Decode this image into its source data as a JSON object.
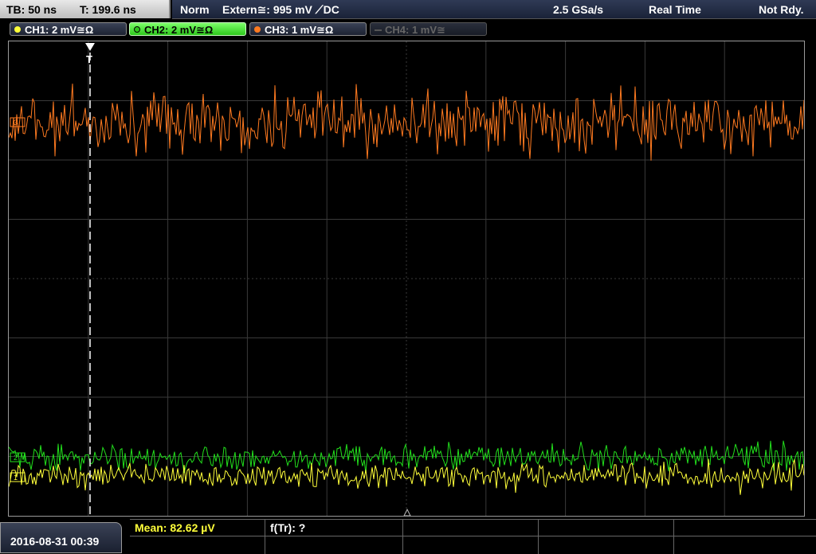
{
  "topbar": {
    "tb": "TB: 50 ns",
    "t": "T: 199.6 ns",
    "mode": "Norm",
    "trigger": "Extern≅: 995 mV ⟋DC",
    "sample_rate": "2.5 GSa/s",
    "acq_mode": "Real Time",
    "state": "Not Rdy."
  },
  "channels": [
    {
      "label": "CH1: 2 mV≅Ω",
      "color": "#ffff3a",
      "state": "on"
    },
    {
      "label": "CH2: 2 mV≅Ω",
      "color": "#2ec81c",
      "state": "active"
    },
    {
      "label": "CH3: 1 mV≅Ω",
      "color": "#ff7a20",
      "state": "on"
    },
    {
      "label": "CH4: 1 mV≅",
      "color": "#666666",
      "state": "off"
    }
  ],
  "bottom": {
    "datetime": "2016-08-31 00:39",
    "mean": "Mean: 82.62 µV",
    "freq": "f(Tr): ?"
  },
  "markers": {
    "trigger": "T",
    "ch3": "3",
    "ch2": "2",
    "ch1": "1"
  },
  "colors": {
    "ch1": "#ffff3a",
    "ch2": "#22e01c",
    "ch3": "#ff7a20",
    "grid": "#3a3a3a"
  }
}
